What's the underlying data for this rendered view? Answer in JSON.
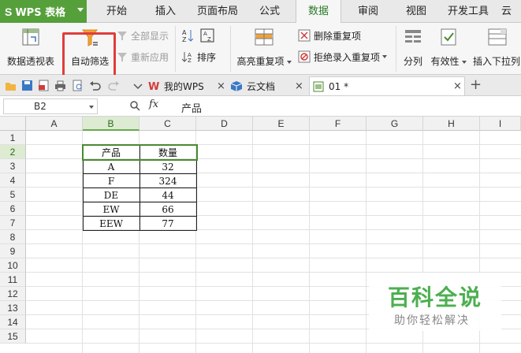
{
  "app": {
    "logo": "S",
    "title": "WPS 表格"
  },
  "menu_tabs": [
    {
      "label": "开始"
    },
    {
      "label": "插入"
    },
    {
      "label": "页面布局"
    },
    {
      "label": "公式"
    },
    {
      "label": "数据",
      "active": true
    },
    {
      "label": "审阅"
    },
    {
      "label": "视图"
    },
    {
      "label": "开发工具"
    },
    {
      "label": "云服"
    }
  ],
  "ribbon": {
    "pivot_table": "数据透视表",
    "auto_filter": "自动筛选",
    "show_all": "全部显示",
    "reapply": "重新应用",
    "sort": "排序",
    "highlight_duplicates": "高亮重复项",
    "remove_duplicates": "删除重复项",
    "reject_duplicates": "拒绝录入重复项",
    "split": "分列",
    "validity": "有效性",
    "insert_dropdown": "插入下拉列"
  },
  "doc_tabs": [
    {
      "label": "我的WPS"
    },
    {
      "label": "云文档"
    },
    {
      "label": "01 *"
    }
  ],
  "formula_bar": {
    "cell_ref": "B2",
    "fx": "fx",
    "content": "产品"
  },
  "columns": [
    "A",
    "B",
    "C",
    "D",
    "E",
    "F",
    "G",
    "H",
    "I"
  ],
  "rows": [
    "1",
    "2",
    "3",
    "4",
    "5",
    "6",
    "7",
    "8",
    "9",
    "10",
    "11",
    "12",
    "13",
    "14",
    "15"
  ],
  "table": {
    "headers": [
      "产品",
      "数量"
    ],
    "rows": [
      [
        "A",
        "32"
      ],
      [
        "F",
        "324"
      ],
      [
        "DE",
        "44"
      ],
      [
        "EW",
        "66"
      ],
      [
        "EEW",
        "77"
      ]
    ]
  },
  "watermark": {
    "title": "百科全说",
    "subtitle": "助你轻松解决"
  },
  "colors": {
    "app_green": "#55a03a",
    "selection_green": "#4a8a2f",
    "highlight_red": "#e03c3c",
    "watermark_green": "#4caf50"
  }
}
